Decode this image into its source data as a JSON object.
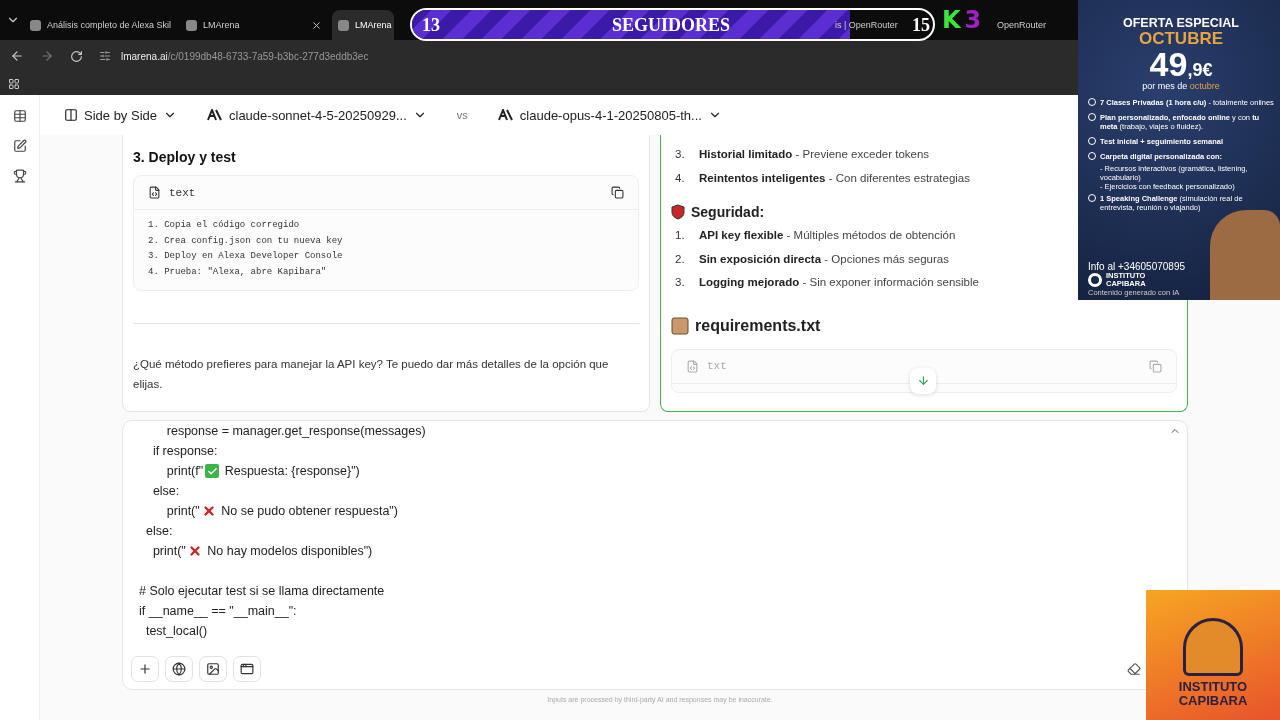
{
  "browser": {
    "tabs": [
      {
        "title": "Análisis completo de Alexa Skil",
        "selected": false
      },
      {
        "title": "LMArena",
        "selected": false
      },
      {
        "title": "LMArena",
        "selected": true
      },
      {
        "title": "is | OpenRouter",
        "selected": false
      },
      {
        "title": "OpenRouter",
        "selected": false
      }
    ],
    "url": {
      "host": "lmarena.ai",
      "path": "/c/0199db48-6733-7a59-b3bc-277d3eddb3ec"
    }
  },
  "header": {
    "mode": "Side by Side",
    "model_a": "claude-sonnet-4-5-20250929...",
    "vs": "vs",
    "model_b": "claude-opus-4-1-20250805-th..."
  },
  "left_panel": {
    "heading": "3. Deploy y test",
    "code_block": {
      "language": "text",
      "lines": [
        "1. Copia el código corregido",
        "2. Crea config.json con tu nueva key",
        "3. Deploy en Alexa Developer Console",
        "4. Prueba: \"Alexa, abre Kapibara\""
      ]
    },
    "question": "¿Qué método prefieres para manejar la API key? Te puedo dar más detalles de la opción que elijas."
  },
  "right_panel": {
    "sections": [
      {
        "kind": "list",
        "items": [
          {
            "number": "3.",
            "text": "**Historial limitado** - Previene exceder tokens"
          },
          {
            "number": "4.",
            "text": "**Reintentos inteligentes** - Con diferentes estrategias"
          }
        ]
      },
      {
        "kind": "heading",
        "text": "Seguridad:"
      },
      {
        "kind": "list",
        "items": [
          {
            "number": "1.",
            "text": "**API key flexible** - Múltiples métodos de obtención"
          },
          {
            "number": "2.",
            "text": "**Sin exposición directa** - Opciones más seguras"
          },
          {
            "number": "3.",
            "text": "**Logging mejorado** - Sin exponer información sensible"
          }
        ]
      },
      {
        "kind": "file_heading",
        "text": "requirements.txt"
      },
      {
        "kind": "code",
        "language": "txt"
      }
    ]
  },
  "composer": {
    "code_lines": [
      {
        "kind": "plain",
        "text": "        response = manager.get_response(messages)"
      },
      {
        "kind": "plain",
        "text": "    if response:"
      },
      {
        "kind": "success",
        "text": "        print(f\"",
        "rest": " Respuesta: {response}\")"
      },
      {
        "kind": "plain",
        "text": "    else:"
      },
      {
        "kind": "error",
        "text": "        print(\"",
        "rest": " No se pudo obtener respuesta\")"
      },
      {
        "kind": "plain",
        "text": "  else:"
      },
      {
        "kind": "error",
        "text": "    print(\"",
        "rest": " No hay modelos disponibles\")"
      },
      {
        "kind": "blank"
      },
      {
        "kind": "plain",
        "text": "# Solo ejecutar test si se llama directamente"
      },
      {
        "kind": "plain",
        "text": "if __name__ == \"__main__\":"
      },
      {
        "kind": "plain",
        "text": "  test_local()"
      }
    ]
  },
  "footer": "Inputs are processed by third-party AI and responses may be inaccurate.",
  "stream_overlay": {
    "followers_current": "13",
    "followers_label": "SEGUIDORES",
    "followers_goal": "15",
    "level": 0.84,
    "logo_letters": [
      "K",
      "3"
    ]
  },
  "ad": {
    "title": "OFERTA ESPECIAL",
    "month": "OCTUBRE",
    "price": "49",
    "price_suffix": ",9€",
    "per": "por mes de ",
    "per_month": "octubre",
    "features": [
      {
        "text": "**7 Clases Privadas (1 hora c/u)** - totalmente onlines"
      },
      {
        "text": "**Plan personalizado, enfocado online** y con **tu meta** (trabajo, viajes o fluidez)."
      },
      {
        "text": "**Test inicial + seguimiento semanal**"
      },
      {
        "text": "**Carpeta digital personalizada con:**",
        "sub": [
          "- Recursos interactivos (gramática, listening, vocabulario)",
          "- Ejercicios con feedback personalizado)"
        ]
      },
      {
        "text": "**1 Speaking Challenge** (simulación real de entrevista, reunión o viajando)"
      }
    ],
    "contact": "Info al +34605070895",
    "brand_top": "INSTITUTO",
    "brand_bottom": "CAPIBARA",
    "disclaimer": "Contenido generado con IA"
  },
  "corner_logo": {
    "top": "INSTITUTO",
    "bottom": "CAPIBARA"
  }
}
